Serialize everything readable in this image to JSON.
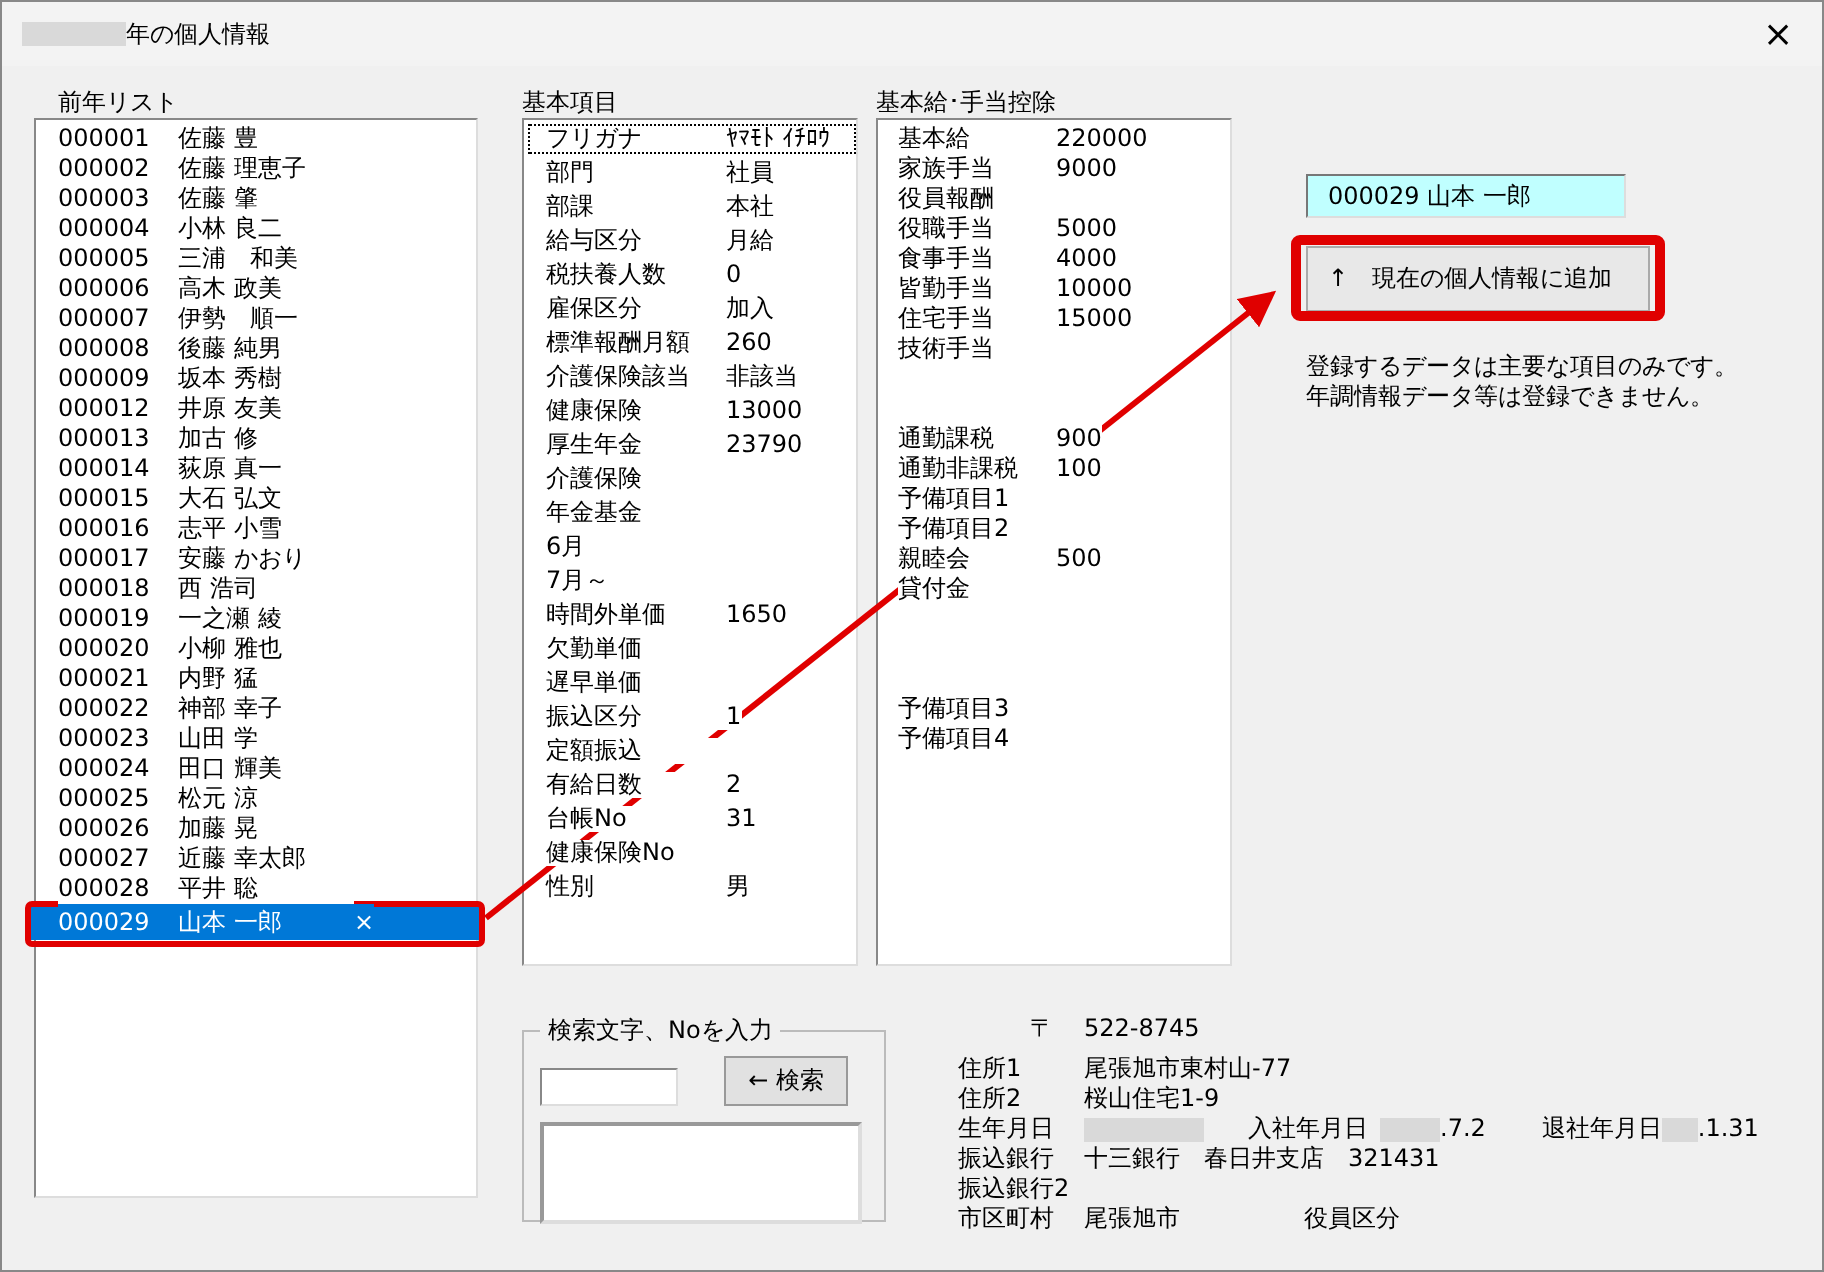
{
  "window": {
    "title": "年の個人情報",
    "close": "×"
  },
  "prev_list": {
    "label": "前年リスト",
    "items": [
      {
        "no": "000001",
        "name": "佐藤 豊",
        "selected": false
      },
      {
        "no": "000002",
        "name": "佐藤 理恵子",
        "selected": false
      },
      {
        "no": "000003",
        "name": "佐藤 肇",
        "selected": false
      },
      {
        "no": "000004",
        "name": "小林 良二",
        "selected": false
      },
      {
        "no": "000005",
        "name": "三浦　和美",
        "selected": false
      },
      {
        "no": "000006",
        "name": "高木 政美",
        "selected": false
      },
      {
        "no": "000007",
        "name": "伊勢　順一",
        "selected": false
      },
      {
        "no": "000008",
        "name": "後藤 純男",
        "selected": false
      },
      {
        "no": "000009",
        "name": "坂本 秀樹",
        "selected": false
      },
      {
        "no": "000012",
        "name": "井原 友美",
        "selected": false
      },
      {
        "no": "000013",
        "name": "加古 修",
        "selected": false
      },
      {
        "no": "000014",
        "name": "荻原 真一",
        "selected": false
      },
      {
        "no": "000015",
        "name": "大石 弘文",
        "selected": false
      },
      {
        "no": "000016",
        "name": "志平 小雪",
        "selected": false
      },
      {
        "no": "000017",
        "name": "安藤 かおり",
        "selected": false
      },
      {
        "no": "000018",
        "name": "西 浩司",
        "selected": false
      },
      {
        "no": "000019",
        "name": "一之瀬 綾",
        "selected": false
      },
      {
        "no": "000020",
        "name": "小柳 雅也",
        "selected": false
      },
      {
        "no": "000021",
        "name": "内野 猛",
        "selected": false
      },
      {
        "no": "000022",
        "name": "神部 幸子",
        "selected": false
      },
      {
        "no": "000023",
        "name": "山田 学",
        "selected": false
      },
      {
        "no": "000024",
        "name": "田口 輝美",
        "selected": false
      },
      {
        "no": "000025",
        "name": "松元 涼",
        "selected": false
      },
      {
        "no": "000026",
        "name": "加藤 晃",
        "selected": false
      },
      {
        "no": "000027",
        "name": "近藤 幸太郎",
        "selected": false
      },
      {
        "no": "000028",
        "name": "平井 聡",
        "selected": false
      },
      {
        "no": "000029",
        "name": "山本 一郎",
        "mark": "×",
        "selected": true
      }
    ]
  },
  "basic": {
    "label": "基本項目",
    "items": [
      {
        "label": "フリガナ",
        "value": "ﾔﾏﾓﾄ ｲﾁﾛｳ",
        "focused": true
      },
      {
        "label": "部門",
        "value": "社員",
        "focused": false
      },
      {
        "label": "部課",
        "value": "本社",
        "focused": false
      },
      {
        "label": "給与区分",
        "value": "月給",
        "focused": false
      },
      {
        "label": "税扶養人数",
        "value": "0",
        "focused": false
      },
      {
        "label": "雇保区分",
        "value": "加入",
        "focused": false
      },
      {
        "label": "標準報酬月額",
        "value": "260",
        "focused": false
      },
      {
        "label": "介護保険該当",
        "value": "非該当",
        "focused": false
      },
      {
        "label": "健康保険",
        "value": "13000",
        "focused": false
      },
      {
        "label": "厚生年金",
        "value": "23790",
        "focused": false
      },
      {
        "label": "介護保険",
        "focused": false
      },
      {
        "label": "年金基金",
        "focused": false
      },
      {
        "label": "6月",
        "focused": false
      },
      {
        "label": "7月～",
        "focused": false
      },
      {
        "label": "時間外単価",
        "value": "1650",
        "focused": false
      },
      {
        "label": "欠勤単価",
        "focused": false
      },
      {
        "label": "遅早単価",
        "focused": false
      },
      {
        "label": "振込区分",
        "value": "1",
        "focused": false
      },
      {
        "label": "定額振込",
        "focused": false
      },
      {
        "label": "有給日数",
        "value": "2",
        "focused": false
      },
      {
        "label": "台帳No",
        "value": "31",
        "focused": false
      },
      {
        "label": "健康保険No",
        "focused": false
      },
      {
        "label": "性別",
        "value": "男",
        "focused": false
      }
    ]
  },
  "salary": {
    "label": "基本給･手当控除",
    "items": [
      {
        "kind": "item",
        "label": "基本給",
        "value": "220000"
      },
      {
        "kind": "item",
        "label": "家族手当",
        "value": "9000"
      },
      {
        "kind": "item",
        "label": "役員報酬"
      },
      {
        "kind": "item",
        "label": "役職手当",
        "value": "5000"
      },
      {
        "kind": "item",
        "label": "食事手当",
        "value": "4000"
      },
      {
        "kind": "item",
        "label": "皆勤手当",
        "value": "10000"
      },
      {
        "kind": "item",
        "label": "住宅手当",
        "value": "15000"
      },
      {
        "kind": "item",
        "label": "技術手当"
      },
      {
        "kind": "blank"
      },
      {
        "kind": "blank"
      },
      {
        "kind": "item",
        "label": "通勤課税",
        "value": "900"
      },
      {
        "kind": "item",
        "label": "通勤非課税",
        "value": "100"
      },
      {
        "kind": "item",
        "label": "予備項目1"
      },
      {
        "kind": "item",
        "label": "予備項目2"
      },
      {
        "kind": "item",
        "label": "親睦会",
        "value": "500"
      },
      {
        "kind": "item",
        "label": "貸付金"
      },
      {
        "kind": "blank"
      },
      {
        "kind": "blank"
      },
      {
        "kind": "blank"
      },
      {
        "kind": "item",
        "label": "予備項目3"
      },
      {
        "kind": "item",
        "label": "予備項目4"
      }
    ]
  },
  "current": {
    "value": "000029 山本 一郎",
    "add_button": "↑　現在の個人情報に追加",
    "note": [
      "登録するデータは主要な項目のみです。",
      "年調情報データ等は登録できません。"
    ]
  },
  "search": {
    "legend": "検索文字、Noを入力",
    "button": "← 検索"
  },
  "info": {
    "postal_mark": "〒",
    "postal": "522-8745",
    "rows": [
      {
        "label": "住所1",
        "value": "尾張旭市東村山-77"
      },
      {
        "label": "住所2",
        "value": "桜山住宅1-9"
      },
      {
        "label": "生年月日",
        "kind": "dates",
        "join_label": "入社年月日",
        "join_value": ".7.2",
        "leave_label": "退社年月日",
        "leave_value": ".1.31"
      },
      {
        "label": "振込銀行",
        "value": "十三銀行　春日井支店　321431"
      },
      {
        "label": "振込銀行2"
      },
      {
        "label": "市区町村",
        "value": "尾張旭市",
        "extra": "役員区分"
      }
    ]
  }
}
